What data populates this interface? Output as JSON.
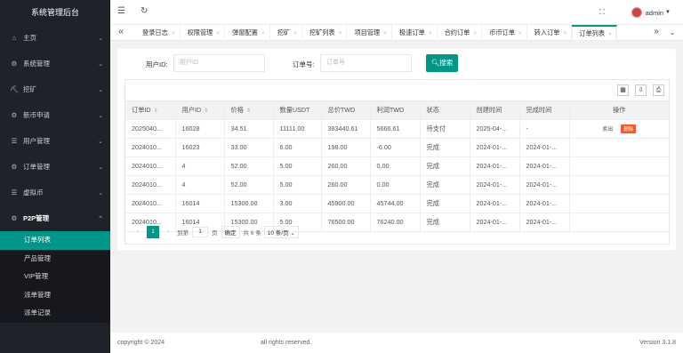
{
  "app_title": "系统管理后台",
  "sidebar": {
    "items": [
      {
        "icon": "home-icon",
        "glyph": "⌂",
        "label": "主页"
      },
      {
        "icon": "settings-icon",
        "glyph": "⚙",
        "label": "系统管理"
      },
      {
        "icon": "mining-icon",
        "glyph": "⛏",
        "label": "挖矿"
      },
      {
        "icon": "coin-icon",
        "glyph": "⚙",
        "label": "新币申请"
      },
      {
        "icon": "user-icon",
        "glyph": "☰",
        "label": "用户管理"
      },
      {
        "icon": "order-icon",
        "glyph": "⚙",
        "label": "订单管理"
      },
      {
        "icon": "currency-icon",
        "glyph": "☰",
        "label": "虚拟币"
      },
      {
        "icon": "p2p-icon",
        "glyph": "⚙",
        "label": "P2P管理"
      }
    ],
    "submenu": [
      "订单列表",
      "产品管理",
      "VIP管理",
      "派单管理",
      "派单记录"
    ],
    "active_sub": "订单列表"
  },
  "header": {
    "menu_icon": "☰",
    "refresh_icon": "↻",
    "fullscreen_icon": "⛶",
    "user": "admin"
  },
  "tabs": [
    "登录日志",
    "权限管理",
    "弹窗配置",
    "挖矿",
    "挖矿列表",
    "项目管理",
    "极速订单",
    "合约订单",
    "币币订单",
    "转入订单",
    "订单列表"
  ],
  "active_tab": "订单列表",
  "search": {
    "user_id_label": "用户ID:",
    "user_id_placeholder": "用户ID",
    "order_no_label": "订单号:",
    "order_no_placeholder": "订单号",
    "search_button": "搜索"
  },
  "table": {
    "columns": [
      "订单ID",
      "用户ID",
      "价格",
      "数量USDT",
      "总价TWD",
      "利润TWD",
      "状态",
      "创建时间",
      "完成时间",
      "操作"
    ],
    "rows": [
      [
        "2025040...",
        "16028",
        "34.51",
        "11111.00",
        "383440.61",
        "5666.61",
        "待支付",
        "2025-04-...",
        "-",
        "op"
      ],
      [
        "2024010...",
        "16023",
        "33.00",
        "6.00",
        "198.00",
        "-6.00",
        "完成",
        "2024-01-...",
        "2024-01-...",
        ""
      ],
      [
        "2024010...",
        "4",
        "52.00",
        "5.00",
        "260.00",
        "0.00",
        "完成",
        "2024-01-...",
        "2024-01-...",
        ""
      ],
      [
        "2024010...",
        "4",
        "52.00",
        "5.00",
        "260.00",
        "0.00",
        "完成",
        "2024-01-...",
        "2024-01-...",
        ""
      ],
      [
        "2024010...",
        "16014",
        "15300.00",
        "3.00",
        "45900.00",
        "45744.00",
        "完成",
        "2024-01-...",
        "2024-01-...",
        ""
      ],
      [
        "2024010...",
        "16014",
        "15300.00",
        "5.00",
        "76500.00",
        "76240.00",
        "完成",
        "2024-01-...",
        "2024-01-...",
        ""
      ]
    ],
    "action_sell": "卖出",
    "action_delete": "删除"
  },
  "pager": {
    "current_page": "1",
    "goto_label": "到第",
    "goto_value": "1",
    "page_unit": "页",
    "confirm": "确定",
    "total": "共 6 条",
    "page_size": "10 条/页"
  },
  "footer": {
    "copyright": "copyright © 2024",
    "rights": "all rights reserved.",
    "version": "Version 3.1.8"
  },
  "colors": {
    "accent": "#009688",
    "sidebar": "#20222a",
    "danger": "#ff5722"
  }
}
